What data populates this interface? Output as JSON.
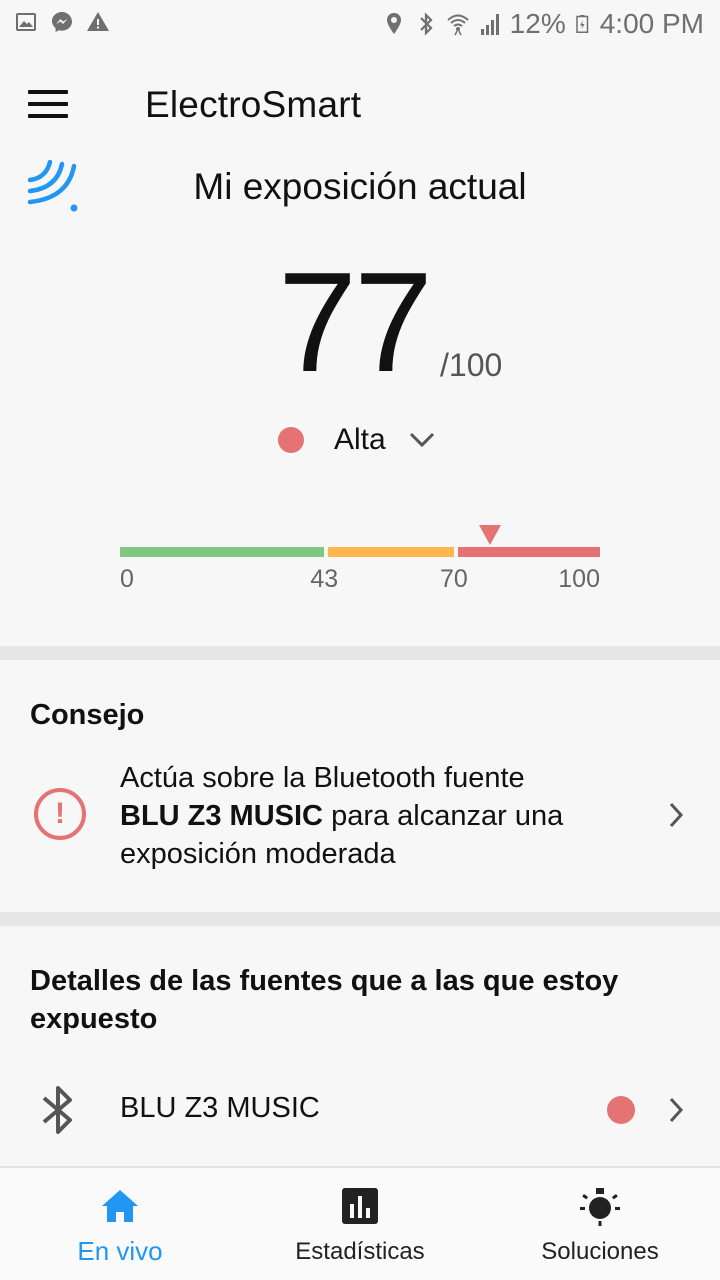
{
  "status_bar": {
    "battery": "12%",
    "time": "4:00 PM",
    "left_icons": [
      "gallery-icon",
      "messenger-icon",
      "warning-icon"
    ],
    "right_icons": [
      "location-icon",
      "bluetooth-icon",
      "wifi-icon",
      "signal-icon",
      "battery-icon"
    ]
  },
  "app_bar": {
    "title": "ElectroSmart",
    "menu_icon": "hamburger-menu-icon"
  },
  "exposure": {
    "title": "Mi exposición actual",
    "score": "77",
    "max": "/100",
    "level_label": "Alta",
    "level_color": "#e57373",
    "scale": {
      "value": 77,
      "ticks": [
        "0",
        "43",
        "70",
        "100"
      ],
      "segments": [
        {
          "from": 0,
          "to": 43,
          "color": "#81c784"
        },
        {
          "from": 43,
          "to": 70,
          "color": "#ffb74d"
        },
        {
          "from": 70,
          "to": 100,
          "color": "#e57373"
        }
      ]
    }
  },
  "advice": {
    "title": "Consejo",
    "text_before": "Actúa sobre la Bluetooth fuente",
    "source_bold": "BLU Z3 MUSIC",
    "text_after": "para alcanzar una exposición moderada"
  },
  "sources": {
    "title": "Detalles de las fuentes que a las que estoy expuesto",
    "items": [
      {
        "name": "BLU Z3 MUSIC",
        "type_icon": "bluetooth-icon",
        "level_color": "#e57373"
      }
    ]
  },
  "bottom_nav": {
    "items": [
      {
        "label": "En vivo",
        "icon": "home-icon",
        "active": true
      },
      {
        "label": "Estadísticas",
        "icon": "bar-chart-icon",
        "active": false
      },
      {
        "label": "Soluciones",
        "icon": "lightbulb-icon",
        "active": false
      }
    ],
    "active_color": "#2196f3"
  }
}
